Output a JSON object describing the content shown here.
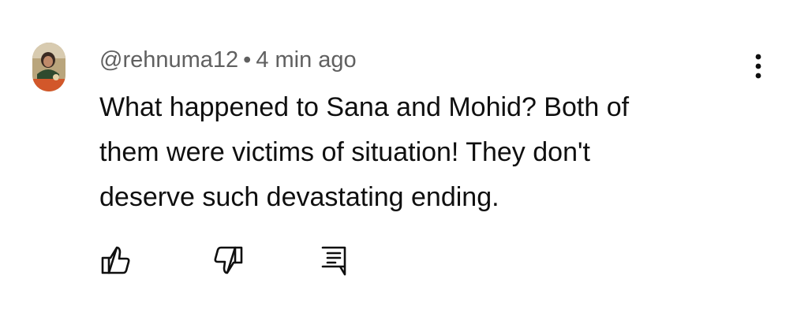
{
  "comment": {
    "author": "@rehnuma12",
    "separator": "•",
    "time": "4 min ago",
    "text_lines": [
      "What happened to Sana and Mohid? Both of",
      "them were victims of situation! They don't",
      "deserve such devastating ending."
    ]
  },
  "icons": {
    "avatar": "user-avatar",
    "menu": "more-vert-icon",
    "like": "thumbs-up-icon",
    "dislike": "thumbs-down-icon",
    "reply": "reply-comment-icon"
  },
  "colors": {
    "meta_text": "#606060",
    "body_text": "#0f0f0f",
    "icon": "#0f0f0f",
    "background": "#ffffff"
  }
}
